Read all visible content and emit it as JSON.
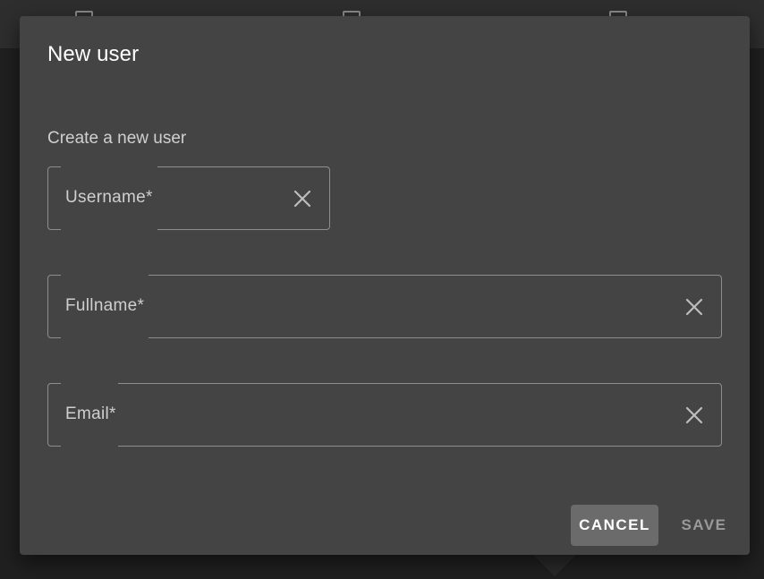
{
  "dialog": {
    "title": "New user",
    "subtitle": "Create a new user",
    "fields": {
      "username": {
        "label": "Username*",
        "value": ""
      },
      "fullname": {
        "label": "Fullname*",
        "value": ""
      },
      "email": {
        "label": "Email*",
        "value": ""
      }
    },
    "actions": {
      "cancel_label": "CANCEL",
      "save_label": "SAVE",
      "save_enabled": false
    }
  },
  "colors": {
    "dialog_bg": "#444444",
    "backdrop": "#202020",
    "field_border": "#8e8e8e",
    "cancel_bg": "#6b6b6b",
    "save_disabled_text": "#9a9a9a"
  },
  "icons": {
    "clear": "close-icon",
    "background_checkbox": "checkbox-icon"
  }
}
